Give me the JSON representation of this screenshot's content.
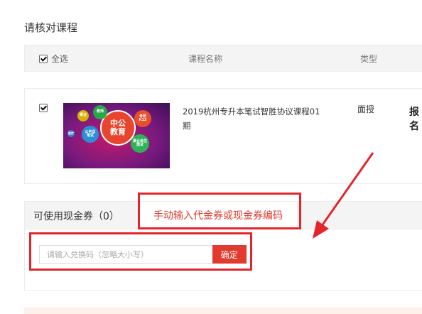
{
  "section_title": "请核对课程",
  "table": {
    "select_all_label": "全选",
    "col_name": "课程名称",
    "col_type": "类型"
  },
  "course": {
    "checked": true,
    "title": "2019杭州专升本笔试智胜协议课程01期",
    "type": "面授",
    "extra": "报名",
    "thumb_labels": {
      "main": "中公\n教育",
      "b1": "事业",
      "b2": "教师",
      "b3": "考研\nK12",
      "b4": "公务员\n笔试",
      "b5": "事业单位\n面试",
      "b6": "医疗"
    }
  },
  "voucher": {
    "label": "可使用现金券（0）",
    "manual_tab": "手动输入代金券或现金券编码",
    "placeholder": "请输入兑换码（忽略大小写）",
    "confirm": "确定"
  },
  "colors": {
    "accent": "#e13b30",
    "annotation": "#e3262c"
  }
}
